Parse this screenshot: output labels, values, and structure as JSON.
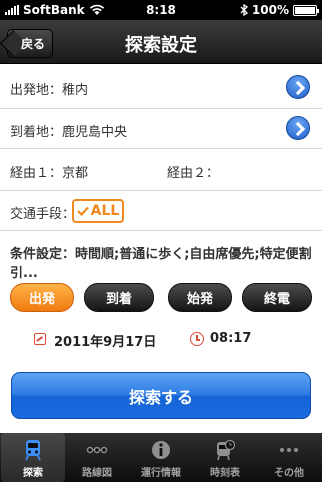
{
  "status": {
    "carrier": "SoftBank",
    "time": "8:18",
    "battery": "100%",
    "battery_level": 1.0
  },
  "nav": {
    "title": "探索設定",
    "back_label": "戻る"
  },
  "form": {
    "departure": "出発地：稚内",
    "arrival": "到着地：鹿児島中央",
    "via1": "経由１：京都",
    "via2": "経由２：",
    "transport_label": "交通手段：",
    "transport_value": "ALL",
    "conditions": "条件設定：時間順;普通に歩く;自由席優先;特定便割引..."
  },
  "segments": {
    "depart": "出発",
    "arrive": "到着",
    "first": "始発",
    "last": "終電",
    "selected": "depart"
  },
  "datetime": {
    "date": "2011年9月17日",
    "time": "08:17"
  },
  "search_button": "探索する",
  "tabs": [
    {
      "label": "探索",
      "icon": "train-icon",
      "active": true
    },
    {
      "label": "路線図",
      "icon": "route-map-icon",
      "active": false
    },
    {
      "label": "運行情報",
      "icon": "info-icon",
      "active": false
    },
    {
      "label": "時刻表",
      "icon": "timetable-icon",
      "active": false
    },
    {
      "label": "その他",
      "icon": "more-icon",
      "active": false
    }
  ],
  "colors": {
    "accent": "#f08a20",
    "primary": "#1f6fe0",
    "bar": "#1a1a1a"
  }
}
